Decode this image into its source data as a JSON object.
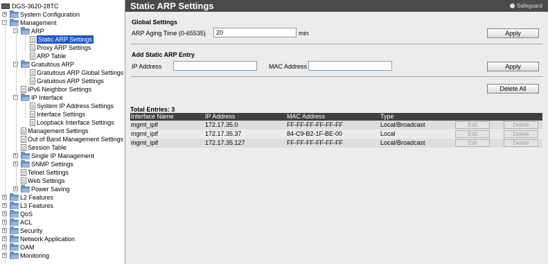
{
  "tree": {
    "root": "DGS-3620-28TC",
    "nodes": [
      {
        "label": "System Configuration",
        "kind": "folder",
        "exp": "+"
      },
      {
        "label": "Management",
        "kind": "folder",
        "exp": "-"
      },
      {
        "label": "ARP",
        "kind": "folder",
        "exp": "-"
      },
      {
        "label": "Static ARP Settings",
        "kind": "page",
        "selected": true
      },
      {
        "label": "Proxy ARP Settings",
        "kind": "page"
      },
      {
        "label": "ARP Table",
        "kind": "page"
      },
      {
        "label": "Gratuitous ARP",
        "kind": "folder",
        "exp": "-"
      },
      {
        "label": "Gratuitous ARP Global Settings",
        "kind": "page"
      },
      {
        "label": "Gratuitous ARP Settings",
        "kind": "page"
      },
      {
        "label": "IPv6 Neighbor Settings",
        "kind": "page"
      },
      {
        "label": "IP Interface",
        "kind": "folder",
        "exp": "-"
      },
      {
        "label": "System IP Address Settings",
        "kind": "page"
      },
      {
        "label": "Interface Settings",
        "kind": "page"
      },
      {
        "label": "Loopback Interface Settings",
        "kind": "page"
      },
      {
        "label": "Management Settings",
        "kind": "page"
      },
      {
        "label": "Out of Band Management Settings",
        "kind": "page"
      },
      {
        "label": "Session Table",
        "kind": "page"
      },
      {
        "label": "Single IP Management",
        "kind": "folder",
        "exp": "+"
      },
      {
        "label": "SNMP Settings",
        "kind": "folder",
        "exp": "+"
      },
      {
        "label": "Telnet Settings",
        "kind": "page"
      },
      {
        "label": "Web Settings",
        "kind": "page"
      },
      {
        "label": "Power Saving",
        "kind": "folder",
        "exp": "+"
      },
      {
        "label": "L2 Features",
        "kind": "folder",
        "exp": "+"
      },
      {
        "label": "L3 Features",
        "kind": "folder",
        "exp": "+"
      },
      {
        "label": "QoS",
        "kind": "folder",
        "exp": "+"
      },
      {
        "label": "ACL",
        "kind": "folder",
        "exp": "+"
      },
      {
        "label": "Security",
        "kind": "folder",
        "exp": "+"
      },
      {
        "label": "Network Application",
        "kind": "folder",
        "exp": "+"
      },
      {
        "label": "OAM",
        "kind": "folder",
        "exp": "+"
      },
      {
        "label": "Monitoring",
        "kind": "folder",
        "exp": "+"
      }
    ]
  },
  "header": {
    "title": "Static ARP Settings",
    "safeguard": "Safeguard"
  },
  "global": {
    "title": "Global Settings",
    "aging_label": "ARP Aging Time (0-65535)",
    "aging_value": "20",
    "unit": "min",
    "apply": "Apply"
  },
  "add_entry": {
    "title": "Add Static ARP Entry",
    "ip_label": "IP Address",
    "ip_value": "",
    "mac_label": "MAC Address",
    "mac_value": "",
    "apply": "Apply"
  },
  "delete_all": "Delete All",
  "total_entries": "Total Entries: 3",
  "table": {
    "columns": [
      "Interface Name",
      "IP Address",
      "MAC Address",
      "Type"
    ],
    "rows": [
      {
        "iface": "mgmt_ipif",
        "ip": "172.17.35.0",
        "mac": "FF-FF-FF-FF-FF-FF",
        "type": "Local/Broadcast",
        "edit": "Edit",
        "delete": "Delete"
      },
      {
        "iface": "mgmt_ipif",
        "ip": "172.17.35.37",
        "mac": "84-C9-B2-1F-BE-00",
        "type": "Local",
        "edit": "Edit",
        "delete": "Delete"
      },
      {
        "iface": "mgmt_ipif",
        "ip": "172.17.35.127",
        "mac": "FF-FF-FF-FF-FF-FF",
        "type": "Local/Broadcast",
        "edit": "Edit",
        "delete": "Delete"
      }
    ]
  }
}
